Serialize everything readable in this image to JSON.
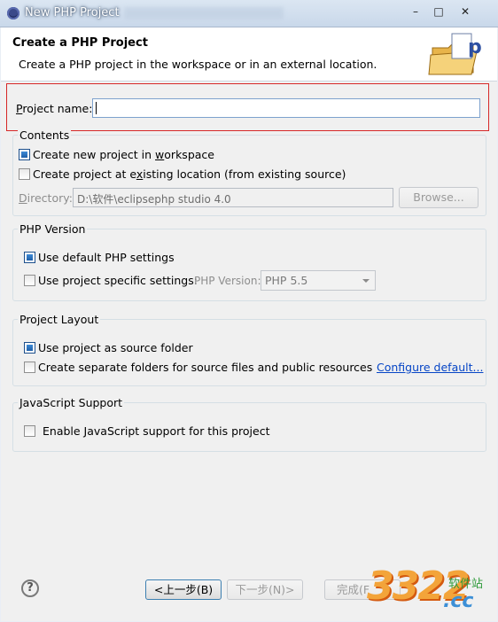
{
  "window": {
    "title": "New PHP Project",
    "min_btn": "–",
    "max_btn": "□",
    "close_btn": "✕"
  },
  "header": {
    "title": "Create a PHP Project",
    "description": "Create a PHP project in the workspace or in an external location."
  },
  "project_name": {
    "label_underlined": "P",
    "label_rest": "roject name:",
    "value": ""
  },
  "contents": {
    "title": "Contents",
    "opt_new_pre": "Create new project in ",
    "opt_new_u": "w",
    "opt_new_post": "orkspace",
    "opt_new_checked": true,
    "opt_existing_pre": "Create project at e",
    "opt_existing_u": "x",
    "opt_existing_post": "isting location (from existing source)",
    "opt_existing_checked": false,
    "dir_label_u": "D",
    "dir_label_rest": "irectory:",
    "dir_value": "D:\\软件\\eclipsephp studio 4.0",
    "browse_label": "Browse...",
    "browse_u": "w"
  },
  "php_version": {
    "title": "PHP Version",
    "opt_default": "Use default PHP settings",
    "opt_default_checked": true,
    "opt_specific": "Use project specific settings:",
    "opt_specific_checked": false,
    "version_label": "PHP Version:",
    "version_value": "PHP 5.5"
  },
  "layout": {
    "title": "Project Layout",
    "opt_source": "Use project as source folder",
    "opt_source_checked": true,
    "opt_separate": "Create separate folders for source files and public resources",
    "opt_separate_checked": false,
    "configure_link": "Configure default..."
  },
  "js": {
    "title": "JavaScript Support",
    "opt_enable": "Enable JavaScript support for this project",
    "opt_enable_checked": false
  },
  "footer": {
    "help_icon": "?",
    "back": "<上一步(B)",
    "next": "下一步(N)>",
    "finish": "完成(F"
  },
  "watermark": {
    "big": "3322",
    "small": "软件站",
    "cc": ".cc"
  },
  "colors": {
    "red_box": "#d62727",
    "link": "#0645c6",
    "accent": "#1e5ea8"
  }
}
